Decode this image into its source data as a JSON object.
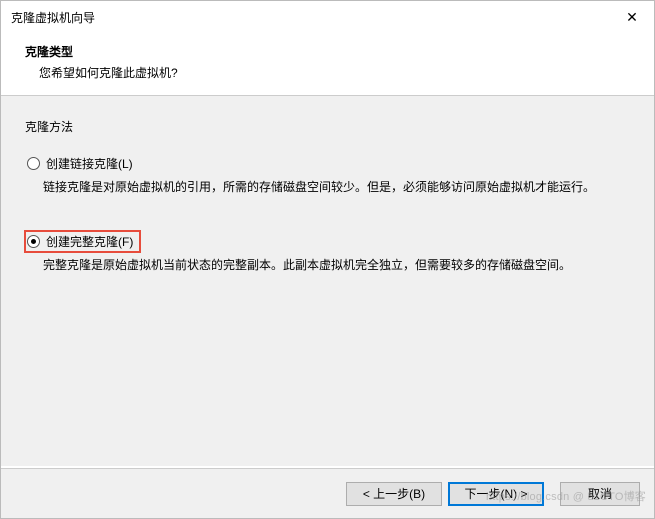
{
  "window": {
    "title": "克隆虚拟机向导"
  },
  "header": {
    "title": "克隆类型",
    "subtitle": "您希望如何克隆此虚拟机?"
  },
  "section": {
    "label": "克隆方法"
  },
  "options": [
    {
      "label": "创建链接克隆(L)",
      "description": "链接克隆是对原始虚拟机的引用，所需的存储磁盘空间较少。但是，必须能够访问原始虚拟机才能运行。",
      "checked": false,
      "highlighted": false
    },
    {
      "label": "创建完整克隆(F)",
      "description": "完整克隆是原始虚拟机当前状态的完整副本。此副本虚拟机完全独立，但需要较多的存储磁盘空间。",
      "checked": true,
      "highlighted": true
    }
  ],
  "footer": {
    "back": "< 上一步(B)",
    "next": "下一步(N) >",
    "cancel": "取消"
  },
  "watermark": "https://blog.csdn @ 51CTO博客"
}
